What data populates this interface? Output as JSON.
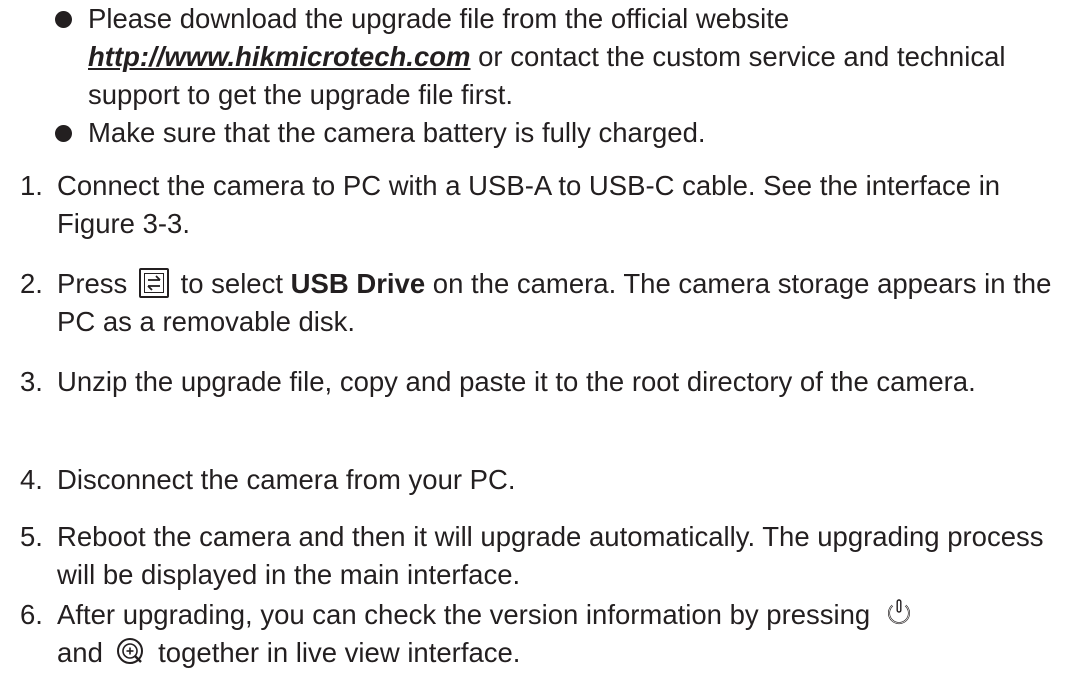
{
  "bullets": [
    {
      "pre": "Please download the upgrade file from the official website ",
      "link": "http://www.hikmicrotech.com",
      "post": " or contact the custom service and technical support to get the upgrade file first."
    },
    {
      "text": "Make sure that the camera battery is fully charged."
    }
  ],
  "steps": [
    {
      "num": "1.",
      "text": "Connect the camera to PC with a USB-A to USB-C cable. See the interface in Figure 3-3."
    },
    {
      "num": "2.",
      "pre": "Press",
      "icon": "menu-switch-button-icon",
      "mid": " to select ",
      "bold": "USB Drive",
      "post": " on the camera. The camera storage appears in the PC as a removable disk."
    },
    {
      "num": "3.",
      "text": "Unzip the upgrade file, copy and paste it to the root directory of the camera."
    },
    {
      "num": "4.",
      "text": "Disconnect the camera from your PC."
    },
    {
      "num": "5.",
      "text": "Reboot the camera and then it will upgrade automatically. The upgrading process will be displayed in the main interface."
    },
    {
      "num": "6.",
      "pre": "After upgrading, you can check the version information by pressing",
      "icon1": "power-icon",
      "mid": "and",
      "icon2": "zoom-in-icon",
      "post": " together in live view interface."
    }
  ],
  "colors": {
    "text": "#231f20",
    "background": "#ffffff"
  }
}
